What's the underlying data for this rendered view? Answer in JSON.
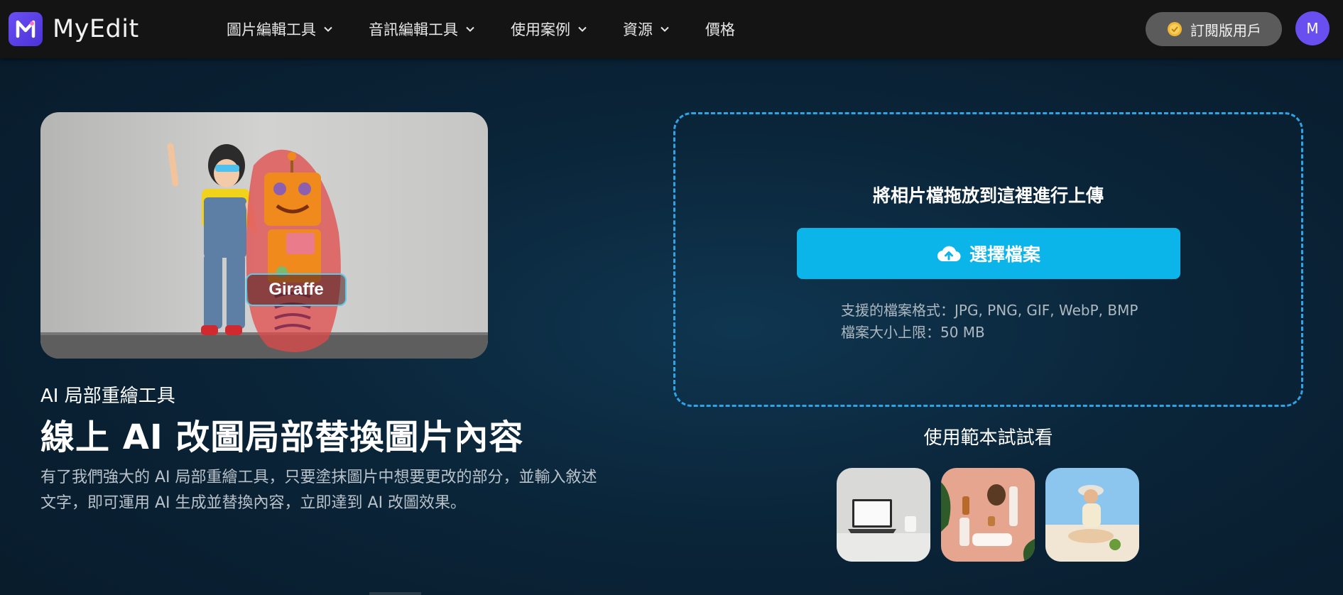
{
  "app": {
    "name": "MyEdit",
    "brand_color": "#5a3ff0"
  },
  "nav": {
    "items": [
      {
        "label": "圖片編輯工具",
        "has_dropdown": true
      },
      {
        "label": "音訊編輯工具",
        "has_dropdown": true
      },
      {
        "label": "使用案例",
        "has_dropdown": true
      },
      {
        "label": "資源",
        "has_dropdown": true
      },
      {
        "label": "價格",
        "has_dropdown": false
      }
    ],
    "subscriber_label": "訂閱版用戶",
    "avatar_initial": "M"
  },
  "hero": {
    "image_tag": "Giraffe",
    "subtitle": "AI 局部重繪工具",
    "title": "線上 AI 改圖局部替換圖片內容",
    "description": "有了我們強大的 AI 局部重繪工具，只要塗抹圖片中想要更改的部分，並輸入敘述文字，即可運用 AI 生成並替換內容，立即達到 AI 改圖效果。"
  },
  "upload": {
    "drop_text": "將相片檔拖放到這裡進行上傳",
    "button_label": "選擇檔案",
    "formats_line": "支援的檔案格式：JPG, PNG, GIF, WebP, BMP",
    "size_line": "檔案大小上限：50 MB",
    "accent_color": "#0bb5ea"
  },
  "samples": {
    "label": "使用範本試試看",
    "items": [
      {
        "icon": "laptop-sample"
      },
      {
        "icon": "cosmetics-sample"
      },
      {
        "icon": "beach-sample"
      }
    ]
  }
}
